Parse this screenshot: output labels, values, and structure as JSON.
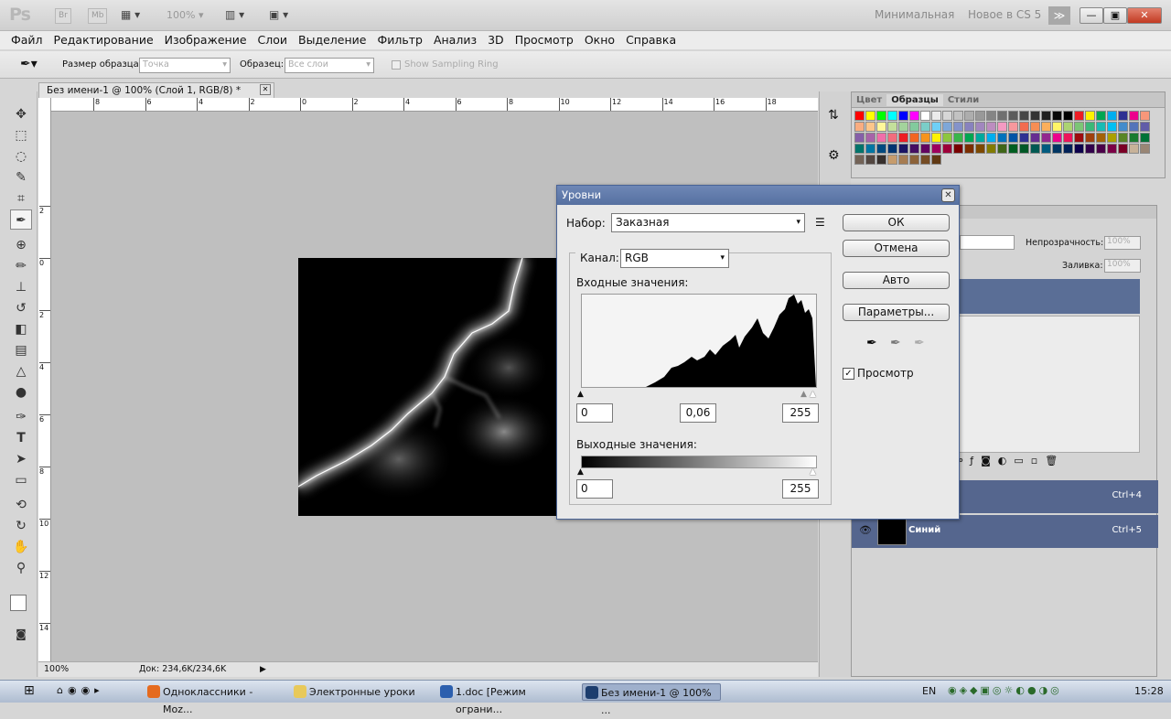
{
  "appbar": {
    "logo": "Ps",
    "br": "Br",
    "mb": "Mb",
    "zoom": "100%",
    "ws_min": "Минимальная",
    "ws_new": "Новое в CS 5",
    "more": "≫",
    "win_min": "—",
    "win_max": "▣",
    "win_close": "✕"
  },
  "menu": [
    "Файл",
    "Редактирование",
    "Изображение",
    "Слои",
    "Выделение",
    "Фильтр",
    "Анализ",
    "3D",
    "Просмотр",
    "Окно",
    "Справка"
  ],
  "options": {
    "size_label": "Размер образца:",
    "size_value": "Точка",
    "sample_label": "Образец:",
    "sample_value": "Все слои",
    "ring_label": "Show Sampling Ring"
  },
  "document": {
    "tab": "Без имени-1 @ 100% (Слой 1, RGB/8) *",
    "close": "✕",
    "top_ruler": [
      "8",
      "6",
      "4",
      "2",
      "0",
      "2",
      "4",
      "6",
      "8",
      "10",
      "12",
      "14",
      "16",
      "18"
    ],
    "left_ruler": [
      "2",
      "0",
      "2",
      "4",
      "6",
      "8",
      "10",
      "12",
      "14"
    ],
    "status_zoom": "100%",
    "status_doc": "Док: 234,6K/234,6K"
  },
  "swatches": {
    "tabs": [
      "Цвет",
      "Образцы",
      "Стили"
    ],
    "colors": [
      "#ff0000",
      "#ffff00",
      "#00ff00",
      "#00ffff",
      "#0000ff",
      "#ff00ff",
      "#ffffff",
      "#ebebeb",
      "#d6d6d6",
      "#c2c2c2",
      "#adadad",
      "#999999",
      "#858585",
      "#707070",
      "#5c5c5c",
      "#474747",
      "#333333",
      "#1f1f1f",
      "#0a0a0a",
      "#000000",
      "#ed1c24",
      "#fff200",
      "#00a651",
      "#00aeef",
      "#2e3192",
      "#ec008c",
      "#f7977a",
      "#f9ad81",
      "#fdc68a",
      "#fff79a",
      "#c4df9b",
      "#a3d39c",
      "#82ca9d",
      "#7bcdc8",
      "#6ecff6",
      "#7ea7d8",
      "#8493ca",
      "#8882be",
      "#a187be",
      "#bc8dbf",
      "#f49ac2",
      "#f6989d",
      "#f26c4f",
      "#f68e55",
      "#fbaf5c",
      "#fff467",
      "#acd372",
      "#7cc576",
      "#3bb878",
      "#1abbb4",
      "#00bff3",
      "#438ccb",
      "#5574b9",
      "#605ca8",
      "#855fa8",
      "#a763a8",
      "#f06ea9",
      "#f26d7d",
      "#ed1c24",
      "#f26522",
      "#f7941d",
      "#fff200",
      "#8dc63f",
      "#39b54a",
      "#00a651",
      "#00a99d",
      "#00aeef",
      "#0072bc",
      "#0054a6",
      "#2e3192",
      "#662d91",
      "#92278f",
      "#ec008c",
      "#ed145b",
      "#9e0b0f",
      "#a0410d",
      "#a36209",
      "#aba000",
      "#598527",
      "#197b30",
      "#007236",
      "#00746b",
      "#0076a3",
      "#004a80",
      "#003471",
      "#1b1464",
      "#440e62",
      "#630460",
      "#9e005d",
      "#9e0039",
      "#790000",
      "#7b2e00",
      "#7d4900",
      "#827b00",
      "#406618",
      "#005e20",
      "#005826",
      "#005952",
      "#005b7f",
      "#003663",
      "#002157",
      "#0d004c",
      "#32004b",
      "#4b0049",
      "#7b0046",
      "#7a0026",
      "#c7b299",
      "#998675",
      "#736357",
      "#534741",
      "#37302d",
      "#c69c6d",
      "#a67c52",
      "#8c6239",
      "#754c24",
      "#603913"
    ]
  },
  "layers": {
    "opacity_label": "Непрозрачность:",
    "opacity_value": "100%",
    "fill_label": "Заливка:",
    "fill_value": "100%",
    "rows": [
      {
        "name": "",
        "shortcut": "Ctrl+4"
      },
      {
        "name": "Синий",
        "shortcut": "Ctrl+5"
      }
    ]
  },
  "dialog": {
    "title": "Уровни",
    "close": "✕",
    "preset_label": "Набор:",
    "preset_value": "Заказная",
    "channel_label": "Канал:",
    "channel_value": "RGB",
    "input_label": "Входные значения:",
    "input_black": "0",
    "input_gamma": "0,06",
    "input_white": "255",
    "output_label": "Выходные значения:",
    "output_black": "0",
    "output_white": "255",
    "ok": "ОК",
    "cancel": "Отмена",
    "auto": "Авто",
    "options": "Параметры...",
    "preview_label": "Просмотр",
    "preview_checked": "✓"
  },
  "taskbar": {
    "items": [
      "Одноклассники - Moz...",
      "Электронные уроки",
      "1.doc [Режим ограни...",
      "Без имени-1 @ 100% ..."
    ],
    "lang": "EN",
    "clock": "15:28"
  }
}
